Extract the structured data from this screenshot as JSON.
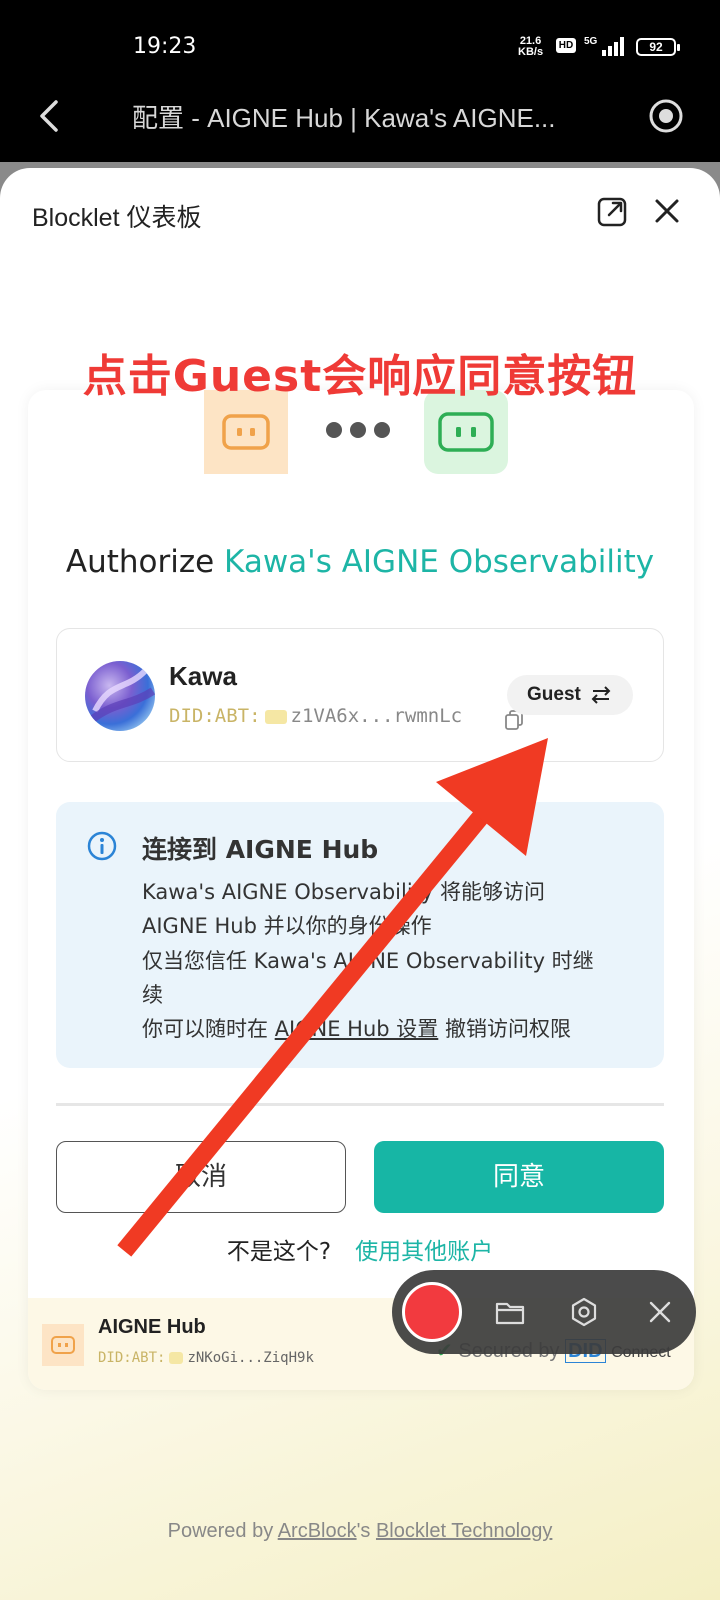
{
  "status_bar": {
    "time": "19:23",
    "net_speed": "21.6",
    "net_unit": "KB/s",
    "hd": "HD",
    "network": "5G",
    "battery": "92"
  },
  "browser": {
    "title": "配置 - AIGNE Hub | Kawa's AIGNE..."
  },
  "sheet": {
    "title": "Blocklet 仪表板"
  },
  "annotation": {
    "text": "点击Guest会响应同意按钮",
    "color": "#ef3a36"
  },
  "authorize": {
    "prefix": "Authorize ",
    "app_name": "Kawa's AIGNE Observability"
  },
  "account": {
    "name": "Kawa",
    "did_prefix": "DID:ABT:",
    "did_value": "z1VA6x...rwmnLc",
    "role_button": "Guest"
  },
  "info": {
    "title": "连接到 AIGNE Hub",
    "line1": "Kawa's AIGNE Observability 将能够访问",
    "line2": "AIGNE Hub 并以你的身份操作",
    "line3": "仅当您信任 Kawa's AIGNE Observability 时继",
    "line4": "续",
    "line5_prefix": "你可以随时在 ",
    "line5_link": "AIGNE Hub 设置",
    "line5_suffix": " 撤销访问权限"
  },
  "actions": {
    "cancel": "取消",
    "agree": "同意",
    "not_you": "不是这个?",
    "use_other": "使用其他账户"
  },
  "hub": {
    "name": "AIGNE Hub",
    "did_prefix": "DID:ABT:",
    "did_value": "zNKoGi...ZiqH9k",
    "secured_by": "Secured by",
    "did_mark": "DID",
    "connect": "Connect"
  },
  "footer": {
    "powered_by": "Powered by ",
    "arcblock": "ArcBlock",
    "s": "'s ",
    "tech": "Blocklet Technology"
  },
  "colors": {
    "accent": "#17b6a5",
    "record": "#f23a3f",
    "arrow": "#f03a23"
  }
}
